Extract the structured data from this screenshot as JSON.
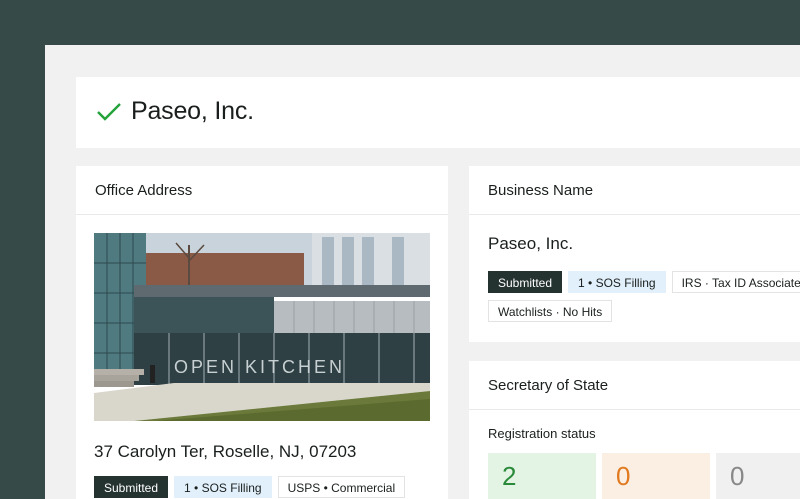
{
  "header": {
    "company_name": "Paseo, Inc.",
    "status_icon": "check-icon",
    "accent_color": "#23a33a"
  },
  "office_address": {
    "heading": "Office Address",
    "photo_sign_text": "OPEN KITCHEN",
    "address": "37 Carolyn Ter, Roselle, NJ, 07203",
    "tags": [
      "Submitted",
      "1 • SOS Filling",
      "USPS • Commercial"
    ]
  },
  "business_name": {
    "heading": "Business Name",
    "name": "Paseo, Inc.",
    "tags": [
      "Submitted",
      "1 • SOS Filling",
      "IRS · Tax ID Associated Name"
    ],
    "tags_row2": [
      "Watchlists · No Hits"
    ]
  },
  "secretary_of_state": {
    "heading": "Secretary of State",
    "registration_label": "Registration status",
    "stats": [
      "2",
      "0",
      "0"
    ]
  }
}
